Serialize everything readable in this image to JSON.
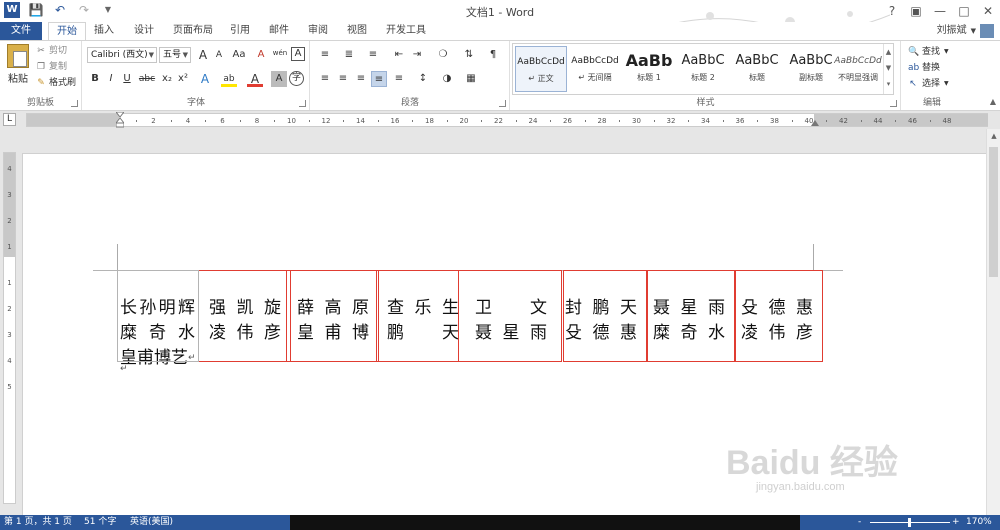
{
  "app": {
    "title": "文档1 - Word",
    "user_name": "刘振斌",
    "help_icon": "?"
  },
  "quick_access": {
    "icons": [
      "word-logo-icon",
      "save-icon",
      "undo-icon",
      "redo-icon",
      "customize-qat-icon"
    ]
  },
  "tabs": [
    {
      "label": "文件"
    },
    {
      "label": "开始"
    },
    {
      "label": "插入"
    },
    {
      "label": "设计"
    },
    {
      "label": "页面布局"
    },
    {
      "label": "引用"
    },
    {
      "label": "邮件"
    },
    {
      "label": "审阅"
    },
    {
      "label": "视图"
    },
    {
      "label": "开发工具"
    }
  ],
  "ribbon": {
    "clipboard": {
      "label": "剪贴板",
      "paste": "粘贴",
      "cut": "剪切",
      "copy": "复制",
      "format_painter": "格式刷"
    },
    "font": {
      "label": "字体",
      "font_name": "Calibri (西文)",
      "font_size": "五号",
      "grow": "A",
      "shrink": "A",
      "case": "Aa",
      "clear": "A",
      "phonetic": "wén",
      "border_char": "A",
      "bold": "B",
      "italic": "I",
      "underline": "U",
      "strike": "abc",
      "sub": "x₂",
      "sup": "x²",
      "effects": "A",
      "highlight": "ab",
      "color": "A",
      "shade": "A",
      "enclose": "字"
    },
    "paragraph": {
      "label": "段落"
    },
    "styles": {
      "label": "样式",
      "items": [
        {
          "preview": "AaBbCcDd",
          "name": "↵ 正文"
        },
        {
          "preview": "AaBbCcDd",
          "name": "↵ 无间隔"
        },
        {
          "preview": "AaBb",
          "name": "标题 1"
        },
        {
          "preview": "AaBbC",
          "name": "标题 2"
        },
        {
          "preview": "AaBbC",
          "name": "标题"
        },
        {
          "preview": "AaBbC",
          "name": "副标题"
        },
        {
          "preview": "AaBbCcDd",
          "name": "不明显强调"
        }
      ]
    },
    "editing": {
      "label": "编辑",
      "find": "查找",
      "replace": "替换",
      "select": "选择"
    }
  },
  "ruler": {
    "h_ticks": [
      "2",
      "4",
      "6",
      "8",
      "10",
      "12",
      "14",
      "16",
      "18",
      "20",
      "22",
      "24",
      "26",
      "28",
      "30",
      "32",
      "34",
      "36",
      "38",
      "40",
      "42",
      "44",
      "46",
      "48"
    ],
    "v_ticks": [
      "4",
      "3",
      "2",
      "1",
      "1",
      "2",
      "3",
      "4",
      "5"
    ],
    "tab_selector": "L"
  },
  "document": {
    "columns": [
      {
        "rows": [
          [
            "长",
            "孙",
            "明",
            "辉"
          ],
          [
            "糜",
            "奇",
            "水"
          ],
          [
            "皇",
            "甫",
            "博",
            "艺"
          ]
        ],
        "end_mark": "↵"
      },
      {
        "rows": [
          [
            "强",
            "凯",
            "旋"
          ],
          [
            "凌",
            "伟",
            "彦"
          ]
        ]
      },
      {
        "rows": [
          [
            "薛",
            "高",
            "原"
          ],
          [
            "皇",
            "甫",
            "博"
          ]
        ]
      },
      {
        "rows": [
          [
            "查",
            "乐",
            "生"
          ],
          [
            "鹏",
            "天"
          ]
        ]
      },
      {
        "rows": [
          [
            "卫",
            "文"
          ],
          [
            "聂",
            "星",
            "雨"
          ]
        ]
      },
      {
        "rows": [
          [
            "封",
            "鹏",
            "天"
          ],
          [
            "殳",
            "德",
            "惠"
          ]
        ]
      },
      {
        "rows": [
          [
            "聂",
            "星",
            "雨"
          ],
          [
            "糜",
            "奇",
            "水"
          ]
        ]
      },
      {
        "rows": [
          [
            "殳",
            "德",
            "惠"
          ],
          [
            "凌",
            "伟",
            "彦"
          ]
        ]
      }
    ],
    "paragraph_mark": "↵",
    "highlight_color": "#e03c31"
  },
  "statusbar": {
    "page": "第 1 页，共 1 页",
    "words": "51 个字",
    "language": "英语(美国)",
    "zoom": "170%",
    "minus": "-",
    "plus": "+"
  },
  "watermark": {
    "brand": "Baidu 经验",
    "url": "jingyan.baidu.com"
  },
  "colors": {
    "accent": "#2b579a",
    "box": "#e03c31"
  }
}
